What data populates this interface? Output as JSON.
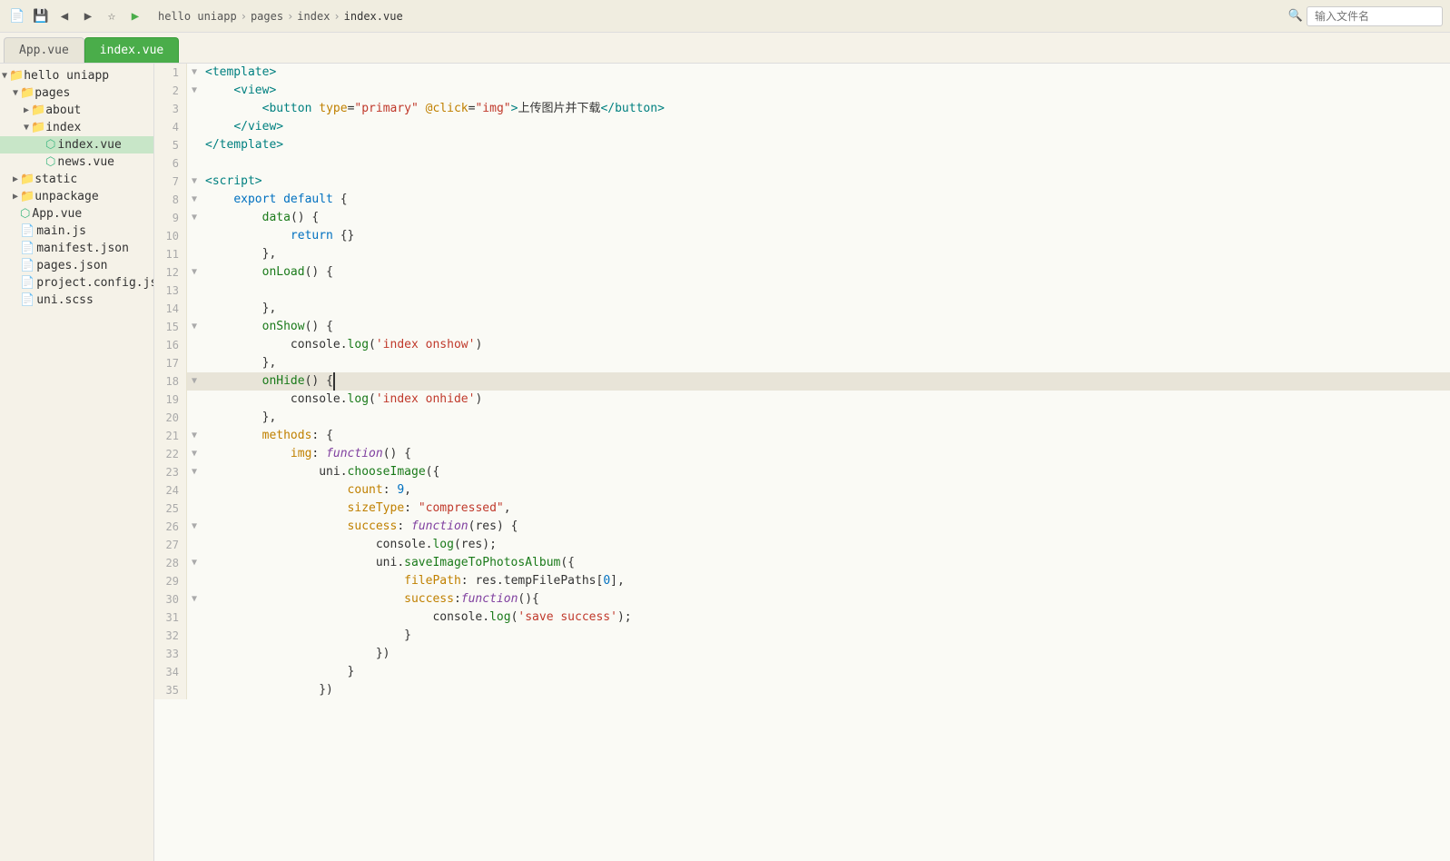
{
  "topbar": {
    "breadcrumb": [
      "hello uniapp",
      "pages",
      "index",
      "index.vue"
    ],
    "search_placeholder": "输入文件名"
  },
  "tabs": [
    {
      "label": "App.vue",
      "active": false
    },
    {
      "label": "index.vue",
      "active": true
    }
  ],
  "sidebar": {
    "root": {
      "label": "hello uniapp",
      "children": [
        {
          "label": "pages",
          "type": "folder",
          "expanded": true,
          "children": [
            {
              "label": "about",
              "type": "folder",
              "expanded": false
            },
            {
              "label": "index",
              "type": "folder",
              "expanded": true,
              "children": [
                {
                  "label": "index.vue",
                  "type": "vue",
                  "selected": true
                },
                {
                  "label": "news.vue",
                  "type": "vue"
                }
              ]
            }
          ]
        },
        {
          "label": "static",
          "type": "folder",
          "expanded": false
        },
        {
          "label": "unpackage",
          "type": "folder",
          "expanded": false
        },
        {
          "label": "App.vue",
          "type": "vue"
        },
        {
          "label": "main.js",
          "type": "js"
        },
        {
          "label": "manifest.json",
          "type": "json"
        },
        {
          "label": "pages.json",
          "type": "json"
        },
        {
          "label": "project.config.json",
          "type": "json"
        },
        {
          "label": "uni.scss",
          "type": "css"
        }
      ]
    }
  },
  "code_lines": [
    {
      "num": 1,
      "fold": "▼",
      "content": "<template>",
      "highlight": false
    },
    {
      "num": 2,
      "fold": "▼",
      "content": "    <view>",
      "highlight": false
    },
    {
      "num": 3,
      "fold": "",
      "content": "        <button type=\"primary\" @click=\"img\">上传图片并下载</button>",
      "highlight": false
    },
    {
      "num": 4,
      "fold": "",
      "content": "    </view>",
      "highlight": false
    },
    {
      "num": 5,
      "fold": "",
      "content": "</template>",
      "highlight": false
    },
    {
      "num": 6,
      "fold": "",
      "content": "",
      "highlight": false
    },
    {
      "num": 7,
      "fold": "▼",
      "content": "<script>",
      "highlight": false
    },
    {
      "num": 8,
      "fold": "▼",
      "content": "    export default {",
      "highlight": false
    },
    {
      "num": 9,
      "fold": "▼",
      "content": "        data() {",
      "highlight": false
    },
    {
      "num": 10,
      "fold": "",
      "content": "            return {}",
      "highlight": false
    },
    {
      "num": 11,
      "fold": "",
      "content": "        },",
      "highlight": false
    },
    {
      "num": 12,
      "fold": "▼",
      "content": "        onLoad() {",
      "highlight": false
    },
    {
      "num": 13,
      "fold": "",
      "content": "",
      "highlight": false
    },
    {
      "num": 14,
      "fold": "",
      "content": "        },",
      "highlight": false
    },
    {
      "num": 15,
      "fold": "▼",
      "content": "        onShow() {",
      "highlight": false
    },
    {
      "num": 16,
      "fold": "",
      "content": "            console.log('index onshow')",
      "highlight": false
    },
    {
      "num": 17,
      "fold": "",
      "content": "        },",
      "highlight": false
    },
    {
      "num": 18,
      "fold": "▼",
      "content": "        onHide() {",
      "highlight": true
    },
    {
      "num": 19,
      "fold": "",
      "content": "            console.log('index onhide')",
      "highlight": false
    },
    {
      "num": 20,
      "fold": "",
      "content": "        },",
      "highlight": false
    },
    {
      "num": 21,
      "fold": "▼",
      "content": "        methods: {",
      "highlight": false
    },
    {
      "num": 22,
      "fold": "▼",
      "content": "            img: function() {",
      "highlight": false
    },
    {
      "num": 23,
      "fold": "▼",
      "content": "                uni.chooseImage({",
      "highlight": false
    },
    {
      "num": 24,
      "fold": "",
      "content": "                    count: 9,",
      "highlight": false
    },
    {
      "num": 25,
      "fold": "",
      "content": "                    sizeType: \"compressed\",",
      "highlight": false
    },
    {
      "num": 26,
      "fold": "▼",
      "content": "                    success: function(res) {",
      "highlight": false
    },
    {
      "num": 27,
      "fold": "",
      "content": "                        console.log(res);",
      "highlight": false
    },
    {
      "num": 28,
      "fold": "▼",
      "content": "                        uni.saveImageToPhotosAlbum({",
      "highlight": false
    },
    {
      "num": 29,
      "fold": "",
      "content": "                            filePath: res.tempFilePaths[0],",
      "highlight": false
    },
    {
      "num": 30,
      "fold": "▼",
      "content": "                            success:function(){",
      "highlight": false
    },
    {
      "num": 31,
      "fold": "",
      "content": "                                console.log('save success');",
      "highlight": false
    },
    {
      "num": 32,
      "fold": "",
      "content": "                            }",
      "highlight": false
    },
    {
      "num": 33,
      "fold": "",
      "content": "                        })",
      "highlight": false
    },
    {
      "num": 34,
      "fold": "",
      "content": "                    }",
      "highlight": false
    },
    {
      "num": 35,
      "fold": "",
      "content": "                })",
      "highlight": false
    }
  ]
}
